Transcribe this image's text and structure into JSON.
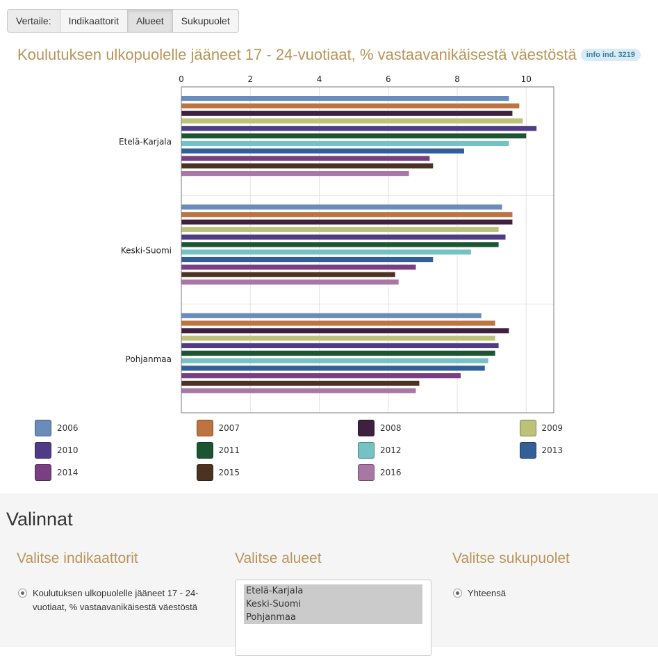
{
  "toolbar": {
    "label": "Vertaile:",
    "buttons": [
      {
        "label": "Indikaattorit",
        "active": false
      },
      {
        "label": "Alueet",
        "active": true
      },
      {
        "label": "Sukupuolet",
        "active": false
      }
    ]
  },
  "info_badge": "info ind. 3219",
  "chart_data": {
    "type": "bar",
    "orientation": "horizontal",
    "title": "Koulutuksen ulkopuolelle jääneet 17 - 24-vuotiaat, % vastaavanikäisestä väestöstä",
    "categories": [
      "Etelä-Karjala",
      "Keski-Suomi",
      "Pohjanmaa"
    ],
    "xlim": [
      0,
      10.8
    ],
    "x_ticks": [
      0,
      2,
      4,
      6,
      8,
      10
    ],
    "grid": true,
    "legend_position": "bottom",
    "series": [
      {
        "name": "2006",
        "color": "#6a8cba",
        "values": [
          9.5,
          9.3,
          8.7
        ]
      },
      {
        "name": "2007",
        "color": "#bd7440",
        "values": [
          9.8,
          9.6,
          9.1
        ]
      },
      {
        "name": "2008",
        "color": "#40203f",
        "values": [
          9.6,
          9.6,
          9.5
        ]
      },
      {
        "name": "2009",
        "color": "#bcc27a",
        "values": [
          9.9,
          9.2,
          9.1
        ]
      },
      {
        "name": "2010",
        "color": "#4f3b86",
        "values": [
          10.3,
          9.4,
          9.2
        ]
      },
      {
        "name": "2011",
        "color": "#1b5532",
        "values": [
          10.0,
          9.2,
          9.1
        ]
      },
      {
        "name": "2012",
        "color": "#74c2c4",
        "values": [
          9.5,
          8.4,
          8.9
        ]
      },
      {
        "name": "2013",
        "color": "#325f98",
        "values": [
          8.2,
          7.3,
          8.8
        ]
      },
      {
        "name": "2014",
        "color": "#7a3f83",
        "values": [
          7.2,
          6.8,
          8.1
        ]
      },
      {
        "name": "2015",
        "color": "#4c3220",
        "values": [
          7.3,
          6.2,
          6.9
        ]
      },
      {
        "name": "2016",
        "color": "#a877a6",
        "values": [
          6.6,
          6.3,
          6.8
        ]
      }
    ]
  },
  "panel": {
    "title": "Valinnat",
    "indicators": {
      "title": "Valitse indikaattorit",
      "option": "Koulutuksen ulkopuolelle jääneet 17 - 24-vuotiaat, % vastaavanikäisestä väestöstä"
    },
    "areas": {
      "title": "Valitse alueet",
      "options": [
        "Etelä-Karjala",
        "Keski-Suomi",
        "Pohjanmaa"
      ]
    },
    "genders": {
      "title": "Valitse sukupuolet",
      "option": "Yhteensä"
    }
  }
}
